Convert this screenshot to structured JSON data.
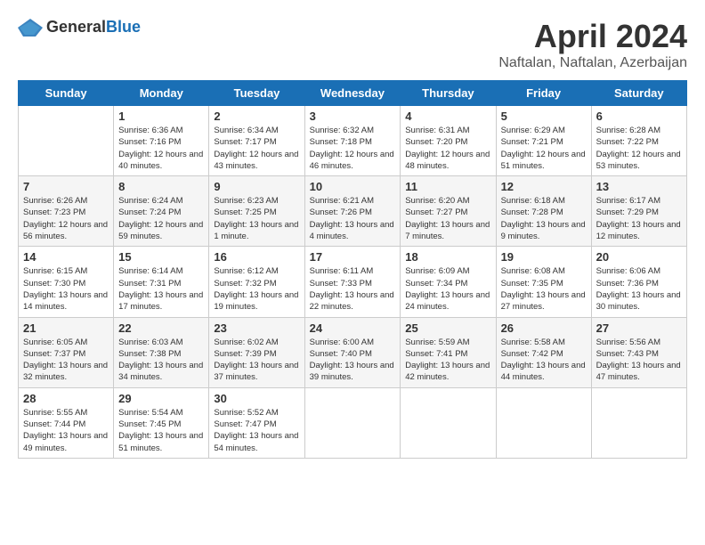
{
  "logo": {
    "text_general": "General",
    "text_blue": "Blue"
  },
  "calendar": {
    "title": "April 2024",
    "subtitle": "Naftalan, Naftalan, Azerbaijan"
  },
  "headers": [
    "Sunday",
    "Monday",
    "Tuesday",
    "Wednesday",
    "Thursday",
    "Friday",
    "Saturday"
  ],
  "weeks": [
    [
      {
        "day": "",
        "info": ""
      },
      {
        "day": "1",
        "info": "Sunrise: 6:36 AM\nSunset: 7:16 PM\nDaylight: 12 hours\nand 40 minutes."
      },
      {
        "day": "2",
        "info": "Sunrise: 6:34 AM\nSunset: 7:17 PM\nDaylight: 12 hours\nand 43 minutes."
      },
      {
        "day": "3",
        "info": "Sunrise: 6:32 AM\nSunset: 7:18 PM\nDaylight: 12 hours\nand 46 minutes."
      },
      {
        "day": "4",
        "info": "Sunrise: 6:31 AM\nSunset: 7:20 PM\nDaylight: 12 hours\nand 48 minutes."
      },
      {
        "day": "5",
        "info": "Sunrise: 6:29 AM\nSunset: 7:21 PM\nDaylight: 12 hours\nand 51 minutes."
      },
      {
        "day": "6",
        "info": "Sunrise: 6:28 AM\nSunset: 7:22 PM\nDaylight: 12 hours\nand 53 minutes."
      }
    ],
    [
      {
        "day": "7",
        "info": "Sunrise: 6:26 AM\nSunset: 7:23 PM\nDaylight: 12 hours\nand 56 minutes."
      },
      {
        "day": "8",
        "info": "Sunrise: 6:24 AM\nSunset: 7:24 PM\nDaylight: 12 hours\nand 59 minutes."
      },
      {
        "day": "9",
        "info": "Sunrise: 6:23 AM\nSunset: 7:25 PM\nDaylight: 13 hours\nand 1 minute."
      },
      {
        "day": "10",
        "info": "Sunrise: 6:21 AM\nSunset: 7:26 PM\nDaylight: 13 hours\nand 4 minutes."
      },
      {
        "day": "11",
        "info": "Sunrise: 6:20 AM\nSunset: 7:27 PM\nDaylight: 13 hours\nand 7 minutes."
      },
      {
        "day": "12",
        "info": "Sunrise: 6:18 AM\nSunset: 7:28 PM\nDaylight: 13 hours\nand 9 minutes."
      },
      {
        "day": "13",
        "info": "Sunrise: 6:17 AM\nSunset: 7:29 PM\nDaylight: 13 hours\nand 12 minutes."
      }
    ],
    [
      {
        "day": "14",
        "info": "Sunrise: 6:15 AM\nSunset: 7:30 PM\nDaylight: 13 hours\nand 14 minutes."
      },
      {
        "day": "15",
        "info": "Sunrise: 6:14 AM\nSunset: 7:31 PM\nDaylight: 13 hours\nand 17 minutes."
      },
      {
        "day": "16",
        "info": "Sunrise: 6:12 AM\nSunset: 7:32 PM\nDaylight: 13 hours\nand 19 minutes."
      },
      {
        "day": "17",
        "info": "Sunrise: 6:11 AM\nSunset: 7:33 PM\nDaylight: 13 hours\nand 22 minutes."
      },
      {
        "day": "18",
        "info": "Sunrise: 6:09 AM\nSunset: 7:34 PM\nDaylight: 13 hours\nand 24 minutes."
      },
      {
        "day": "19",
        "info": "Sunrise: 6:08 AM\nSunset: 7:35 PM\nDaylight: 13 hours\nand 27 minutes."
      },
      {
        "day": "20",
        "info": "Sunrise: 6:06 AM\nSunset: 7:36 PM\nDaylight: 13 hours\nand 30 minutes."
      }
    ],
    [
      {
        "day": "21",
        "info": "Sunrise: 6:05 AM\nSunset: 7:37 PM\nDaylight: 13 hours\nand 32 minutes."
      },
      {
        "day": "22",
        "info": "Sunrise: 6:03 AM\nSunset: 7:38 PM\nDaylight: 13 hours\nand 34 minutes."
      },
      {
        "day": "23",
        "info": "Sunrise: 6:02 AM\nSunset: 7:39 PM\nDaylight: 13 hours\nand 37 minutes."
      },
      {
        "day": "24",
        "info": "Sunrise: 6:00 AM\nSunset: 7:40 PM\nDaylight: 13 hours\nand 39 minutes."
      },
      {
        "day": "25",
        "info": "Sunrise: 5:59 AM\nSunset: 7:41 PM\nDaylight: 13 hours\nand 42 minutes."
      },
      {
        "day": "26",
        "info": "Sunrise: 5:58 AM\nSunset: 7:42 PM\nDaylight: 13 hours\nand 44 minutes."
      },
      {
        "day": "27",
        "info": "Sunrise: 5:56 AM\nSunset: 7:43 PM\nDaylight: 13 hours\nand 47 minutes."
      }
    ],
    [
      {
        "day": "28",
        "info": "Sunrise: 5:55 AM\nSunset: 7:44 PM\nDaylight: 13 hours\nand 49 minutes."
      },
      {
        "day": "29",
        "info": "Sunrise: 5:54 AM\nSunset: 7:45 PM\nDaylight: 13 hours\nand 51 minutes."
      },
      {
        "day": "30",
        "info": "Sunrise: 5:52 AM\nSunset: 7:47 PM\nDaylight: 13 hours\nand 54 minutes."
      },
      {
        "day": "",
        "info": ""
      },
      {
        "day": "",
        "info": ""
      },
      {
        "day": "",
        "info": ""
      },
      {
        "day": "",
        "info": ""
      }
    ]
  ]
}
